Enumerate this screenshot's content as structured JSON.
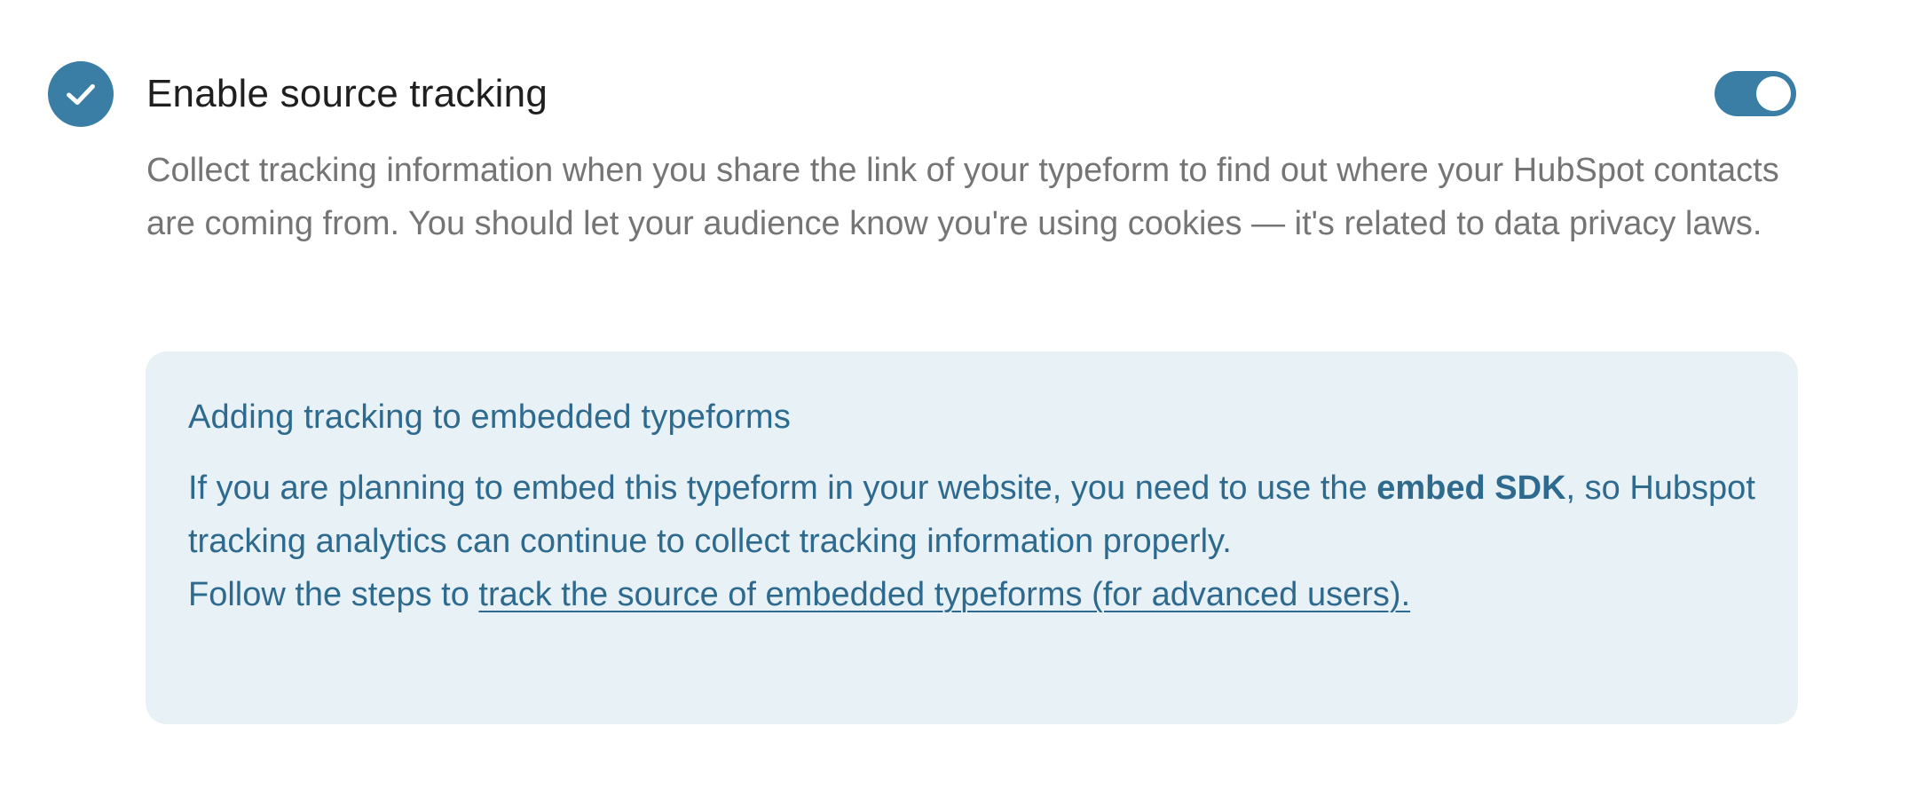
{
  "setting": {
    "icon": "check-circle-icon",
    "title": "Enable source tracking",
    "enabled": true,
    "description": "Collect tracking information when you share the link of your typeform to find out where your HubSpot contacts are coming from. You should let your audience know you're using cookies — it's related to data privacy laws."
  },
  "info_box": {
    "title": "Adding tracking to embedded typeforms",
    "body_before": "If you are planning to embed this typeform in your website, you need to use the ",
    "body_strong": "embed SDK",
    "body_after": ", so Hubspot tracking analytics can continue to collect tracking information properly.",
    "follow_text": "Follow the steps to ",
    "link_label": "track the source of embedded typeforms (for advanced users)."
  },
  "colors": {
    "accent": "#3a7ea6",
    "info_text": "#2d6a8e",
    "info_background": "#e8f1f6",
    "description_text": "#757575",
    "title_text": "#1f1f1f"
  }
}
